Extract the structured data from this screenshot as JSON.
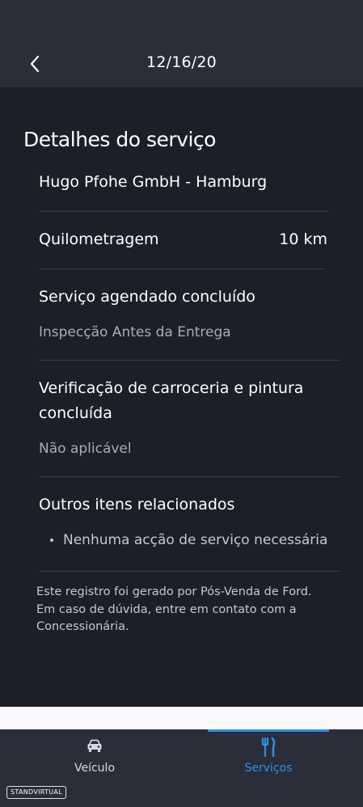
{
  "header": {
    "title": "12/16/20",
    "back_icon": "chevron-left-icon"
  },
  "service": {
    "section_title": "Detalhes do serviço",
    "dealer": "Hugo Pfohe GmbH - Hamburg",
    "mileage_label": "Quilometragem",
    "mileage_value": "10 km",
    "scheduled_title": "Serviço agendado concluído",
    "scheduled_value": "Inspecção Antes da Entrega",
    "bodywork_title": "Verificação de carroceria e pintura concluída",
    "bodywork_value": "Não aplicável",
    "other_title": "Outros itens relacionados",
    "other_items": [
      "Nenhuma acção de serviço necessária"
    ],
    "footnote": "Este registro foi gerado por Pós-Venda de Ford. Em caso de dúvida, entre em contato com a Concessionária."
  },
  "navbar": {
    "items": [
      {
        "label": "Veículo",
        "icon": "car-icon",
        "active": false
      },
      {
        "label": "Serviços",
        "icon": "tools-icon",
        "active": true
      }
    ],
    "active_color": "#2f8fe8"
  },
  "watermark": "STANDVIRTUAL"
}
